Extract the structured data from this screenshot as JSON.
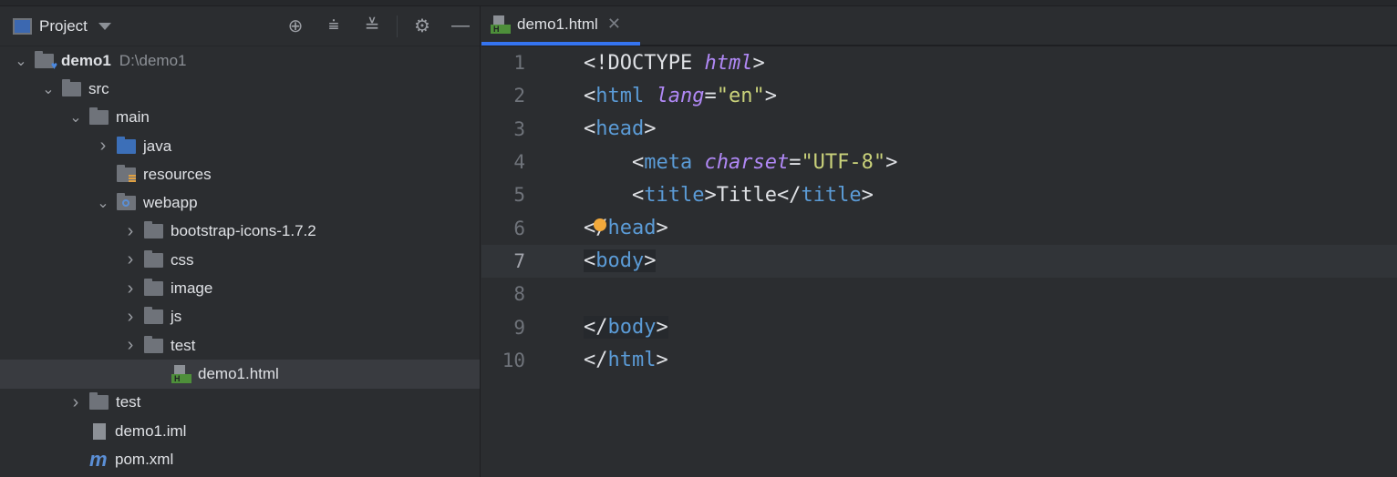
{
  "sidebar": {
    "title": "Project",
    "tools": [
      "locate-icon",
      "expand-all-icon",
      "collapse-all-icon",
      "gear-icon",
      "minimize-icon"
    ],
    "tree": [
      {
        "label": "demo1",
        "path": "D:\\demo1",
        "depth": 0,
        "type": "module",
        "expanded": true
      },
      {
        "label": "src",
        "depth": 1,
        "type": "folder",
        "expanded": true
      },
      {
        "label": "main",
        "depth": 2,
        "type": "folder",
        "expanded": true
      },
      {
        "label": "java",
        "depth": 3,
        "type": "source-folder",
        "expanded": false
      },
      {
        "label": "resources",
        "depth": 3,
        "type": "resources-folder"
      },
      {
        "label": "webapp",
        "depth": 3,
        "type": "web-folder",
        "expanded": true
      },
      {
        "label": "bootstrap-icons-1.7.2",
        "depth": 4,
        "type": "folder",
        "expanded": false
      },
      {
        "label": "css",
        "depth": 4,
        "type": "folder",
        "expanded": false
      },
      {
        "label": "image",
        "depth": 4,
        "type": "folder",
        "expanded": false
      },
      {
        "label": "js",
        "depth": 4,
        "type": "folder",
        "expanded": false
      },
      {
        "label": "test",
        "depth": 4,
        "type": "folder",
        "expanded": false
      },
      {
        "label": "demo1.html",
        "depth": 5,
        "type": "html",
        "selected": true
      },
      {
        "label": "test",
        "depth": 2,
        "type": "folder",
        "expanded": false
      },
      {
        "label": "demo1.iml",
        "depth": 2,
        "type": "iml"
      },
      {
        "label": "pom.xml",
        "depth": 2,
        "type": "maven"
      }
    ]
  },
  "editor": {
    "tab": "demo1.html",
    "current_line": 7,
    "lines": [
      [
        [
          "<!DOCTYPE ",
          "w"
        ],
        [
          "html",
          "a"
        ],
        [
          ">",
          "w"
        ]
      ],
      [
        [
          "<",
          "w"
        ],
        [
          "html",
          "t"
        ],
        [
          " ",
          ""
        ],
        [
          "lang",
          "a"
        ],
        [
          "=",
          "w"
        ],
        [
          "\"en\"",
          "s"
        ],
        [
          ">",
          "w"
        ]
      ],
      [
        [
          "<",
          "w"
        ],
        [
          "head",
          "t"
        ],
        [
          ">",
          "w"
        ]
      ],
      [
        [
          "    <",
          "w"
        ],
        [
          "meta",
          "t"
        ],
        [
          " ",
          ""
        ],
        [
          "charset",
          "a"
        ],
        [
          "=",
          "w"
        ],
        [
          "\"UTF-8\"",
          "s"
        ],
        [
          ">",
          "w"
        ]
      ],
      [
        [
          "    <",
          "w"
        ],
        [
          "title",
          "t"
        ],
        [
          ">Title</",
          "w"
        ],
        [
          "title",
          "t"
        ],
        [
          ">",
          "w"
        ]
      ],
      [
        [
          "</",
          "w"
        ],
        [
          "head",
          "t"
        ],
        [
          ">",
          "w"
        ]
      ],
      [
        [
          "<",
          "w"
        ],
        [
          "body",
          "t"
        ],
        [
          ">",
          "w"
        ]
      ],
      [],
      [
        [
          "</",
          "w"
        ],
        [
          "body",
          "t"
        ],
        [
          ">",
          "w"
        ]
      ],
      [
        [
          "</",
          "w"
        ],
        [
          "html",
          "t"
        ],
        [
          ">",
          "w"
        ]
      ]
    ]
  }
}
